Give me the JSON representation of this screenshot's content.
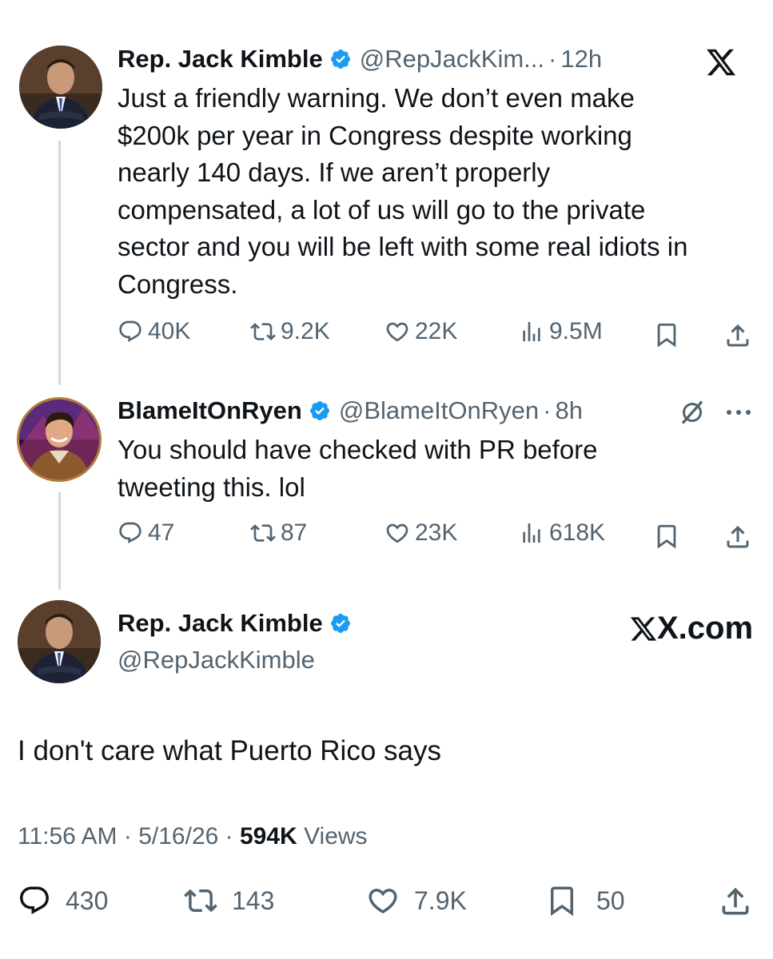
{
  "tweet1": {
    "name": "Rep. Jack Kimble",
    "handle": "@RepJackKim...",
    "dot": "·",
    "time": "12h",
    "text_lines": [
      "Just a friendly warning. We don’t even make",
      "$200k per year in Congress despite working",
      "nearly 140 days.  If we aren’t properly",
      "compensated, a lot of us will go to the private",
      "sector and you will be left with some real idiots in",
      "Congress."
    ],
    "replies": "40K",
    "retweets": "9.2K",
    "likes": "22K",
    "views": "9.5M"
  },
  "tweet2": {
    "name": "BlameItOnRyen",
    "handle": "@BlameItOnRyen",
    "dot": "·",
    "time": "8h",
    "text_lines": [
      "You should have checked with PR before",
      "tweeting this. lol"
    ],
    "replies": "47",
    "retweets": "87",
    "likes": "23K",
    "views": "618K"
  },
  "tweet3": {
    "name": "Rep. Jack Kimble",
    "handle": "@RepJackKimble",
    "brand": "X.com",
    "text": "I don't care what Puerto Rico says",
    "time": "11:56 AM",
    "date": "5/16/26",
    "dot": "·",
    "views_count": "594K",
    "views_label": "Views",
    "replies": "430",
    "retweets": "143",
    "likes": "7.9K",
    "bookmarks": "50"
  },
  "colors": {
    "verified": "#1d9bf0",
    "muted_text": "#536471",
    "text": "#0f1419",
    "thread_line": "#cfd9de"
  },
  "icons": [
    "x-logo-icon",
    "verified-badge-icon",
    "reply-icon",
    "retweet-icon",
    "like-icon",
    "views-icon",
    "bookmark-icon",
    "share-icon",
    "grok-icon",
    "more-icon"
  ]
}
